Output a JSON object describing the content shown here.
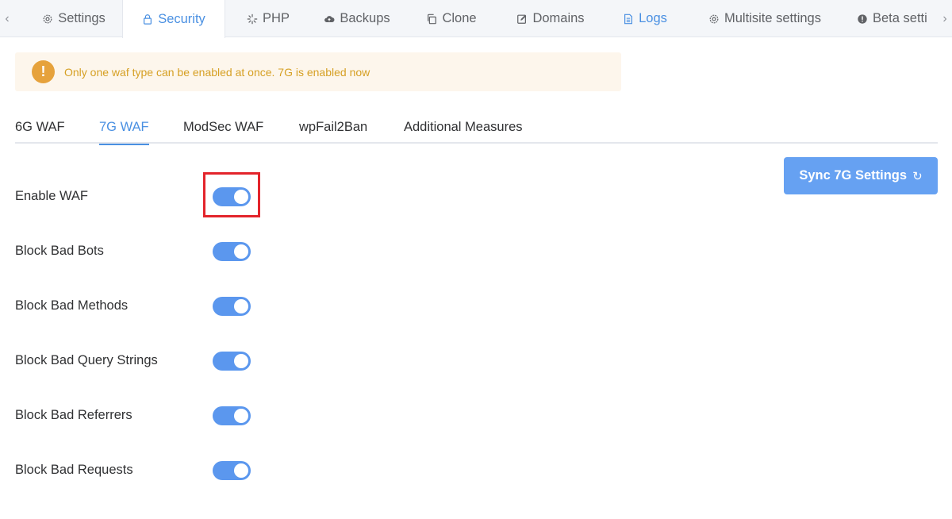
{
  "top_tabs": {
    "scroll_left": "‹",
    "scroll_right": "›",
    "items": [
      {
        "label": "Settings",
        "icon": "gear-icon"
      },
      {
        "label": "Security",
        "icon": "lock-icon"
      },
      {
        "label": "PHP",
        "icon": "spinner-icon"
      },
      {
        "label": "Backups",
        "icon": "cloud-upload-icon"
      },
      {
        "label": "Clone",
        "icon": "copy-icon"
      },
      {
        "label": "Domains",
        "icon": "edit-icon"
      },
      {
        "label": "Logs",
        "icon": "document-icon"
      },
      {
        "label": "Multisite settings",
        "icon": "gear-icon"
      },
      {
        "label": "Beta setti",
        "icon": "exclamation-circle-icon"
      }
    ],
    "active": "Security"
  },
  "alert": {
    "icon": "!",
    "text": "Only one waf type can be enabled at once. 7G is enabled now",
    "color": "#e6a23c"
  },
  "sub_tabs": {
    "items": [
      "6G WAF",
      "7G WAF",
      "ModSec WAF",
      "wpFail2Ban",
      "Additional Measures"
    ],
    "active": "7G WAF"
  },
  "sync_button": {
    "label": "Sync 7G Settings",
    "icon": "refresh-icon",
    "icon_glyph": "↻"
  },
  "settings": [
    {
      "label": "Enable WAF",
      "enabled": true
    },
    {
      "label": "Block Bad Bots",
      "enabled": true
    },
    {
      "label": "Block Bad Methods",
      "enabled": true
    },
    {
      "label": "Block Bad Query Strings",
      "enabled": true
    },
    {
      "label": "Block Bad Referrers",
      "enabled": true
    },
    {
      "label": "Block Bad Requests",
      "enabled": true
    }
  ],
  "colors": {
    "accent": "#4a90e2",
    "switch_on": "#5b97ee",
    "highlight": "#e3242b"
  }
}
